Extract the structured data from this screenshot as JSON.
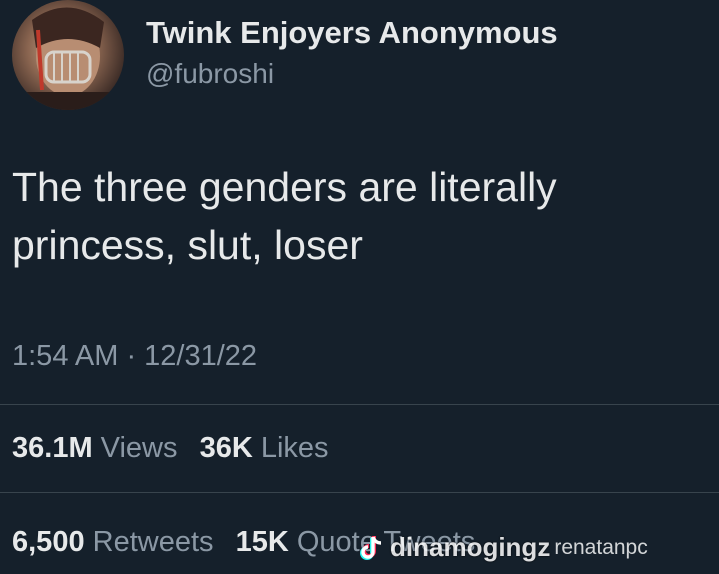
{
  "author": {
    "display_name": "Twink Enjoyers Anonymous",
    "handle": "@fubroshi",
    "avatar_icon": "profile-avatar"
  },
  "tweet": {
    "text_lines": [
      "The three genders are literally",
      "princess, slut, loser"
    ],
    "timestamp": "1:54 AM · 12/31/22"
  },
  "stats": {
    "views_count": "36.1M",
    "views_label": "Views",
    "likes_count": "36K",
    "likes_label": "Likes",
    "retweets_count": "6,500",
    "retweets_label": "Retweets",
    "quotes_count": "15K",
    "quotes_label": "Quote Tweets"
  },
  "watermark": {
    "icon": "tiktok-icon",
    "name": "dinamogingz",
    "user": "renatanpc"
  },
  "colors": {
    "background": "#15202b",
    "primary_text": "#e7e9ea",
    "secondary_text": "#8b98a5",
    "divider": "#38444d"
  }
}
